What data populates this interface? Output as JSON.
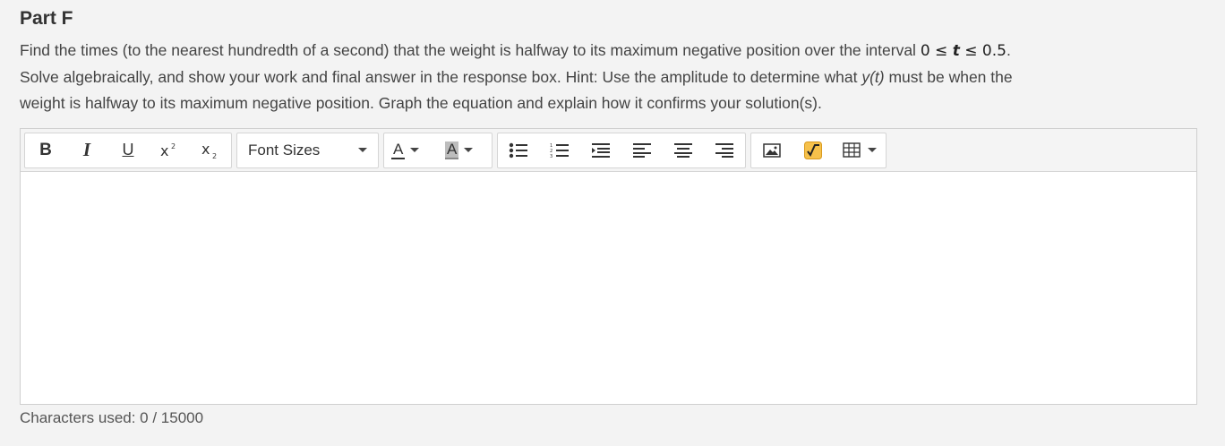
{
  "part": {
    "title": "Part F"
  },
  "prompt": {
    "line1_a": "Find the times (to the nearest hundredth of a second) that the weight is halfway to its maximum negative position over the interval ",
    "math_lo": "0",
    "math_le1": "≤",
    "math_var": "t",
    "math_le2": "≤",
    "math_hi": "0.5",
    "line1_end": ".",
    "line2_a": "Solve algebraically, and show your work and final answer in the response box. Hint: Use the amplitude to determine what ",
    "line2_yt": "y(t)",
    "line2_b": " must be when the",
    "line3": "weight is halfway to its maximum negative position. Graph the equation and explain how it confirms your solution(s)."
  },
  "toolbar": {
    "bold_label": "B",
    "italic_label": "I",
    "underline_label": "U",
    "font_sizes_label": "Font Sizes",
    "text_color_label": "A",
    "bg_color_label": "A",
    "icons": [
      "bold-icon",
      "italic-icon",
      "underline-icon",
      "superscript-icon",
      "subscript-icon",
      "bullet-list-icon",
      "numbered-list-icon",
      "indent-icon",
      "align-left-icon",
      "align-center-icon",
      "align-right-icon",
      "image-icon",
      "equation-icon",
      "table-icon"
    ]
  },
  "editor": {
    "content": ""
  },
  "footer": {
    "chars_used": "Characters used: 0 / 15000"
  }
}
